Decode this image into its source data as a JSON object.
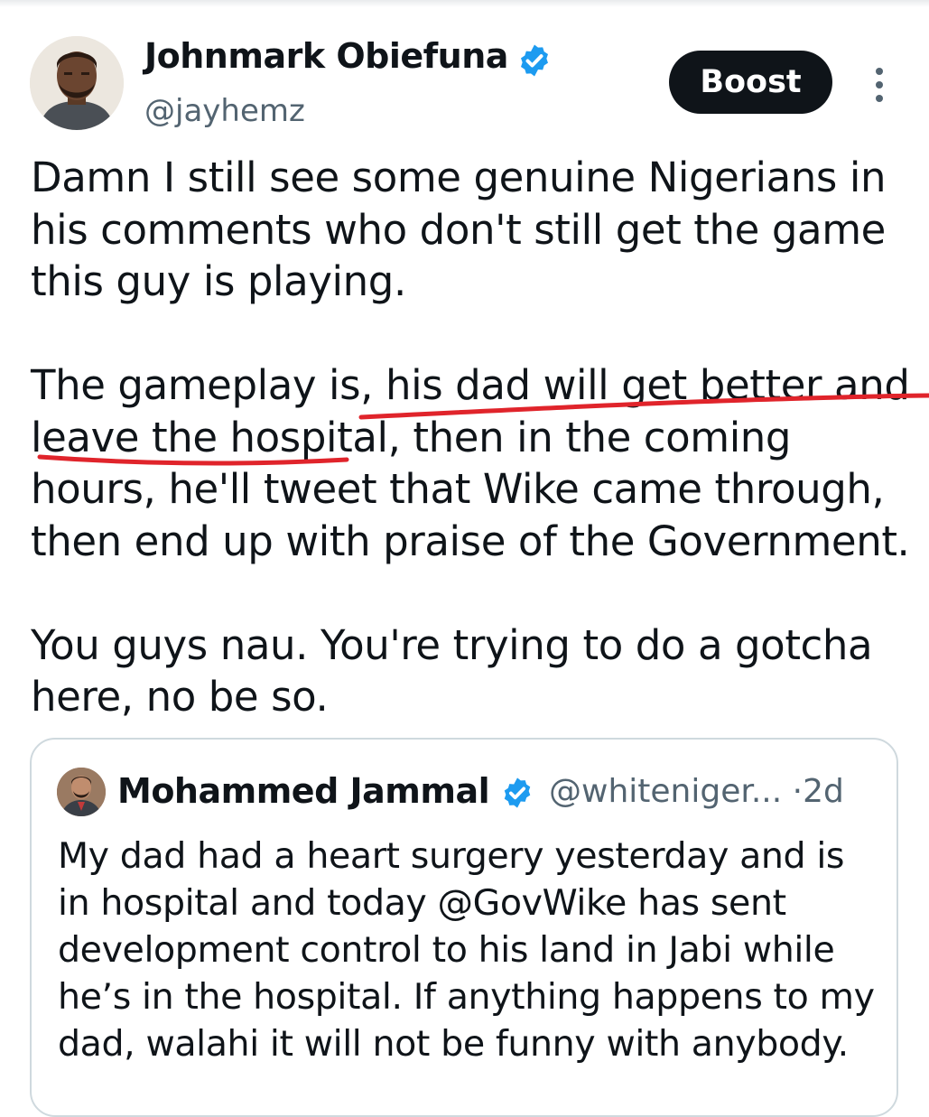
{
  "tweet": {
    "author": {
      "name": "Johnmark Obiefuna",
      "handle": "@jayhemz",
      "verified": true
    },
    "boost_label": "Boost",
    "more_icon": "more-vertical-icon",
    "paragraphs": [
      [
        "Damn I still see some genuine Nigerians in",
        "his comments who don't still get the game",
        "this guy is playing."
      ],
      [
        "The gameplay is, his dad will get better and",
        "leave the hospital, then in the coming",
        "hours, he'll tweet that Wike came through,",
        "then end up with praise of the Government."
      ],
      [
        "You guys nau. You're trying to do a gotcha",
        "here, no be so."
      ]
    ],
    "annotation": {
      "type": "hand-drawn underline",
      "color": "#e0242b",
      "covers": "his dad will get better and leave the hospital"
    }
  },
  "quoted_tweet": {
    "author": {
      "name": "Mohammed Jammal",
      "handle": "@whiteniger...",
      "verified": true
    },
    "separator": "·",
    "age": "2d",
    "lines": [
      "My dad had a heart surgery yesterday and is",
      "in hospital and today @GovWike has sent",
      "development control to his land in Jabi while",
      "he’s in the hospital. If anything happens to my",
      "dad, walahi it will not be funny with anybody."
    ]
  },
  "colors": {
    "text": "#0f1419",
    "secondary_text": "#536471",
    "verified_blue": "#1d9bf0",
    "boost_bg": "#0f1419",
    "card_border": "#cfd9de",
    "underline": "#e0242b"
  }
}
